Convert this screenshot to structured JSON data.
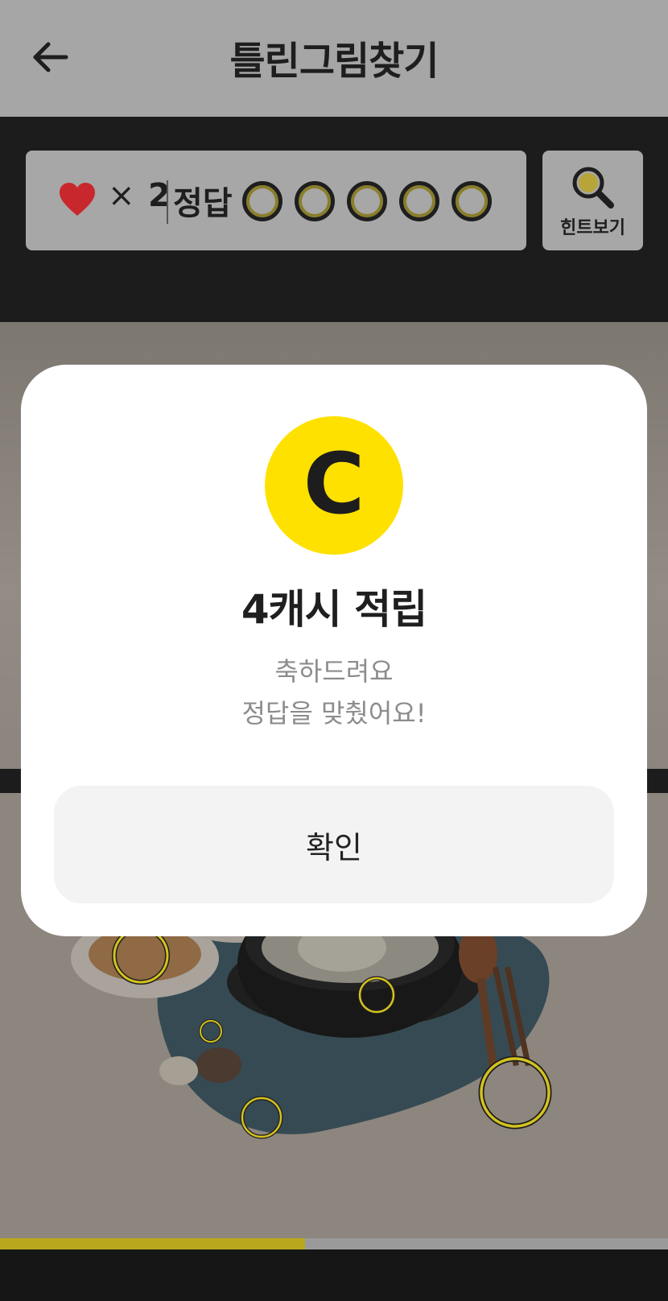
{
  "header": {
    "title": "틀린그림찾기",
    "back_icon": "arrow-left-icon"
  },
  "status": {
    "lives_icon": "heart-icon",
    "multiply_sign": "×",
    "lives_count": "2",
    "answer_label": "정답",
    "answer_slots_total": 5,
    "answer_slots_found": 0,
    "hint_label": "힌트보기",
    "hint_icon": "magnifier-icon"
  },
  "progress": {
    "fraction": 0.457
  },
  "modal": {
    "coin_icon": "cash-coin-icon",
    "coin_letter": "C",
    "title": "4캐시 적립",
    "message_line1": "축하드려요",
    "message_line2": "정답을 맞췄어요!",
    "confirm_label": "확인"
  },
  "colors": {
    "accent_yellow": "#ffe100",
    "marker_yellow": "#d4c21f",
    "heart_red": "#c8282d",
    "dim_overlay": "#a6a6a6"
  }
}
